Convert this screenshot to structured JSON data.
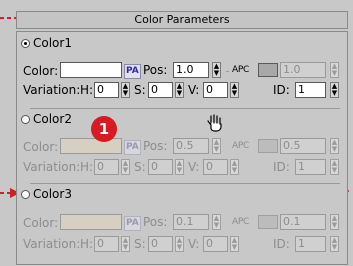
{
  "header": {
    "title": "Color Parameters"
  },
  "labels": {
    "color": "Color:",
    "variation": "Variation:",
    "pos": "Pos:",
    "h": "H:",
    "s": "S:",
    "v": "V:",
    "id": "ID:",
    "pa": "PA",
    "apc": "APC"
  },
  "groups": [
    {
      "name": "Color1",
      "pos": "1.0",
      "pos_val": "1.0",
      "h": "0",
      "s": "0",
      "v": "0",
      "id": "1"
    },
    {
      "name": "Color2",
      "pos": "0.5",
      "pos_val": "0.5",
      "h": "0",
      "s": "0",
      "v": "0",
      "id": "1"
    },
    {
      "name": "Color3",
      "pos": "0.1",
      "pos_val": "0.1",
      "h": "0",
      "s": "0",
      "v": "0",
      "id": "1"
    }
  ],
  "annotation": {
    "badge": "1"
  },
  "colors": {
    "color1_swatch": "#ffffff",
    "color2_swatch": "#d6d0c2",
    "color3_swatch": "#d6d0c2",
    "annotation_red": "#d81a22"
  }
}
